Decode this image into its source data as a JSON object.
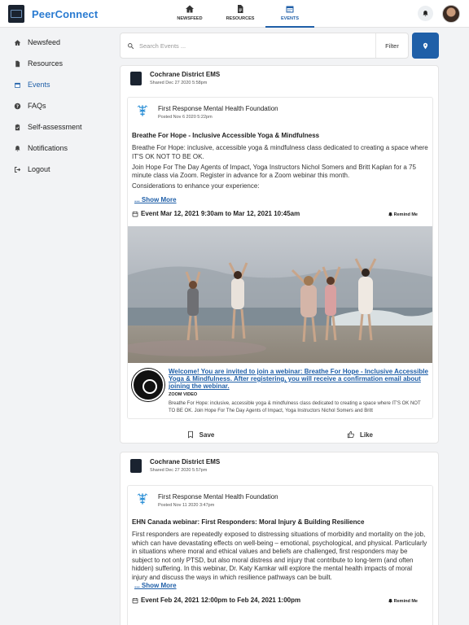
{
  "brand": {
    "name": "PeerConnect"
  },
  "nav": {
    "tabs": [
      {
        "label": "NEWSFEED",
        "icon": "home-icon"
      },
      {
        "label": "RESOURCES",
        "icon": "document-icon"
      },
      {
        "label": "EVENTS",
        "icon": "calendar-icon",
        "active": true
      }
    ]
  },
  "sidebar": {
    "items": [
      {
        "label": "Newsfeed",
        "icon": "home-icon"
      },
      {
        "label": "Resources",
        "icon": "document-icon"
      },
      {
        "label": "Events",
        "icon": "calendar-icon",
        "active": true
      },
      {
        "label": "FAQs",
        "icon": "question-circle-icon"
      },
      {
        "label": "Self-assessment",
        "icon": "clipboard-icon"
      },
      {
        "label": "Notifications",
        "icon": "bell-icon"
      },
      {
        "label": "Logout",
        "icon": "logout-icon"
      }
    ]
  },
  "search": {
    "placeholder": "Search Events ...",
    "filter_label": "Filter"
  },
  "colors": {
    "accent": "#1f5fa8",
    "brand": "#2a7bd1",
    "background": "#f2f3f5"
  },
  "posts": [
    {
      "poster": "Cochrane District EMS",
      "shared": "Shared Dec 27 2020 5:58pm",
      "org": "First Response Mental Health Foundation",
      "posted": "Posted Nov 6 2020 5:22pm",
      "title": "Breathe For Hope - Inclusive Accessible Yoga & Mindfulness",
      "desc": [
        "Breathe For Hope: inclusive, accessible yoga & mindfulness class dedicated to creating a space where IT'S OK NOT TO BE OK.",
        "Join Hope For The Day Agents of Impact, Yoga Instructors Nichol Somers and Britt Kaplan for a 75 minute class via Zoom. Register in advance for a Zoom webinar this month.",
        "Considerations to enhance your experience:"
      ],
      "show_more": "... Show More",
      "event_date": "Event Mar 12, 2021 9:30am to Mar 12, 2021 10:45am",
      "remind": "Remind Me",
      "link": {
        "title": "Welcome! You are invited to join a webinar: Breathe For Hope - Inclusive Accessible Yoga & Mindfulness. After registering, you will receive a confirmation email about joining the webinar.",
        "site": "ZOOM VIDEO",
        "desc": "Breathe For Hope: inclusive, accessible yoga & mindfulness class dedicated to creating a space where IT'S OK NOT TO BE OK. Join Hope For The Day Agents of Impact, Yoga Instructors Nichol Somers and Britt"
      },
      "save_label": "Save",
      "like_label": "Like"
    },
    {
      "poster": "Cochrane District EMS",
      "shared": "Shared Dec 27 2020 5:57pm",
      "org": "First Response Mental Health Foundation",
      "posted": "Posted Nov 11 2020 3:47pm",
      "title": "EHN Canada webinar: First Responders: Moral Injury & Building Resilience",
      "desc": [
        "First responders are repeatedly exposed to distressing situations of morbidity and mortality on the job, which can have devastating effects on well-being – emotional, psychological, and physical. Particularly in situations where moral and ethical values and beliefs are challenged, first responders may be subject to not only PTSD, but also moral distress and injury that contribute to long-term (and often hidden) suffering. In this webinar, Dr. Katy Kamkar will explore the mental health impacts of moral injury and discuss the ways in which resilience pathways can be built."
      ],
      "show_more": "... Show More",
      "event_date": "Event Feb 24, 2021 12:00pm to Feb 24, 2021 1:00pm",
      "remind": "Remind Me"
    }
  ]
}
